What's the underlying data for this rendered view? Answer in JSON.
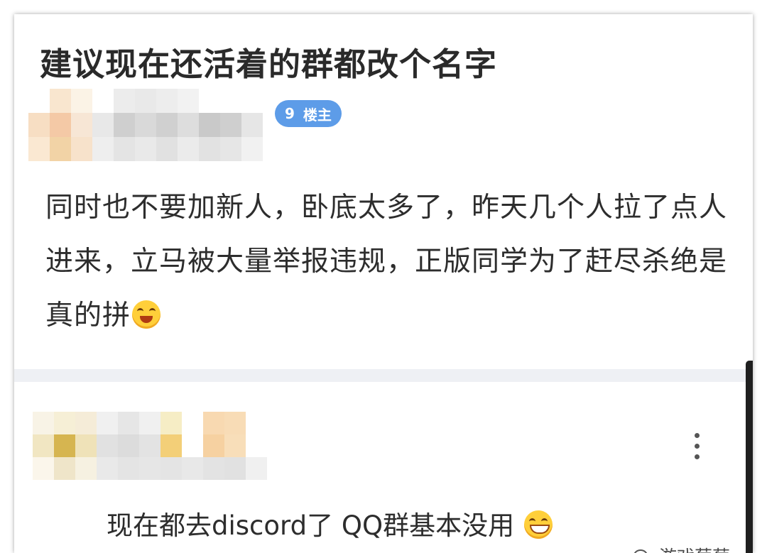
{
  "post": {
    "title": "建议现在还活着的群都改个名字",
    "badge_floor": "9",
    "badge_label": "楼主",
    "body": "同时也不要加新人，卧底太多了，昨天几个人拉了点人进来，立马被大量举报违规，正版同学为了赶尽杀绝是真的拼",
    "body_emoji_icon": "squinting-laughing-face-icon"
  },
  "reply": {
    "text": "现在都去discord了 QQ群基本没用",
    "emoji_icon": "grinning-face-icon"
  },
  "watermark": {
    "text": "游戏葡萄",
    "icon": "wechat-icon"
  },
  "colors": {
    "badge": "#5d9ce8",
    "divider": "#eef0f4",
    "emoji": "#ffcf3a"
  }
}
